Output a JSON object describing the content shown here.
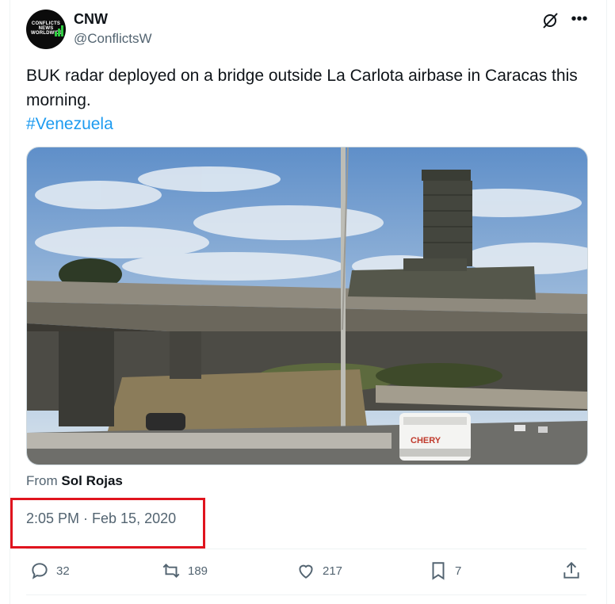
{
  "author": {
    "name": "CNW",
    "handle": "@ConflictsW",
    "avatar_lines": [
      "CONFLICTS",
      "NEWS",
      "WORLDWIDE"
    ]
  },
  "tweet": {
    "text": "BUK radar deployed on a bridge outside La Carlota airbase in Caracas this morning.",
    "hashtag": "#Venezuela",
    "source_prefix": "From",
    "source_name": "Sol Rojas",
    "timestamp": "2:05 PM · Feb 15, 2020"
  },
  "media": {
    "truck_brand": "CHERY"
  },
  "actions": {
    "replies": "32",
    "reposts": "189",
    "likes": "217",
    "bookmarks": "7"
  },
  "icons": [
    "grok-icon",
    "more-icon",
    "reply-icon",
    "repost-icon",
    "like-icon",
    "bookmark-icon",
    "share-icon"
  ],
  "colors": {
    "link": "#1d9bf0",
    "secondary_text": "#536471",
    "highlight": "#e0141e"
  }
}
